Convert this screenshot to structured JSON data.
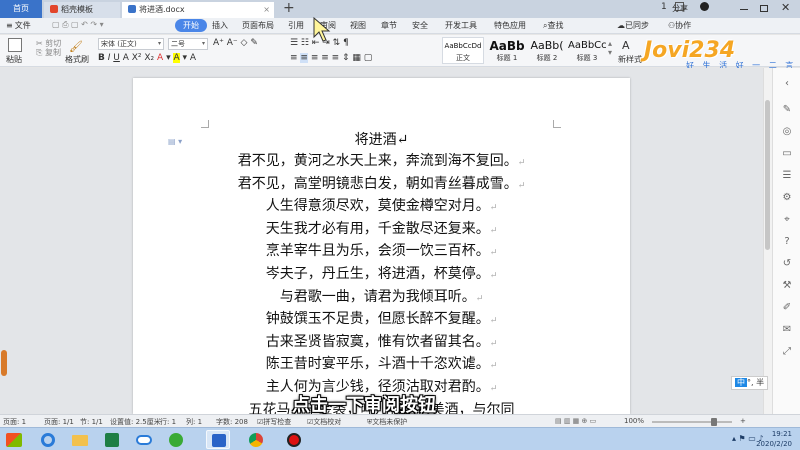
{
  "tabs": {
    "home": "首页",
    "docer": "稻壳模板",
    "document": "将进酒.docx",
    "new_tab": "+"
  },
  "window": {
    "badge": "1",
    "share": "分享",
    "sync": "已同步",
    "collab": "协作"
  },
  "menu": {
    "file": "文件",
    "items": [
      "开始",
      "插入",
      "页面布局",
      "引用",
      "审阅",
      "视图",
      "章节",
      "安全",
      "开发工具",
      "特色应用"
    ],
    "search": "查找"
  },
  "ribbon": {
    "paste": "粘贴",
    "cut": "剪切",
    "copy": "复制",
    "format_painter": "格式刷",
    "font_name": "宋体 (正文)",
    "font_size": "二号",
    "new_style": "新样式",
    "styles": [
      {
        "preview": "AaBbCcDd",
        "name": "正文"
      },
      {
        "preview": "AaBb",
        "name": "标题 1"
      },
      {
        "preview": "AaBb(",
        "name": "标题 2"
      },
      {
        "preview": "AaBbCc",
        "name": "标题 3"
      }
    ]
  },
  "document": {
    "title": "将进酒",
    "lines": [
      "君不见，黄河之水天上来，奔流到海不复回。",
      "君不见，高堂明镜悲白发，朝如青丝暮成雪。",
      "人生得意须尽欢，莫使金樽空对月。",
      "天生我才必有用，千金散尽还复来。",
      "烹羊宰牛且为乐，会须一饮三百杯。",
      "岑夫子，丹丘生，将进酒，杯莫停。",
      "与君歌一曲，请君为我倾耳听。",
      "钟鼓馔玉不足贵，但愿长醉不复醒。",
      "古来圣贤皆寂寞，惟有饮者留其名。",
      "陈王昔时宴平乐，斗酒十千恣欢谑。",
      "主人何为言少钱，径须沽取对君酌。",
      "五花马，千金裘，呼儿将出换美酒，与尔同"
    ],
    "paragraph_mark": "↵"
  },
  "status": {
    "page": "页面: 1",
    "pages": "页面: 1/1",
    "section": "节: 1/1",
    "setting": "设置值: 2.5厘米",
    "row": "行: 1",
    "col": "列: 1",
    "words": "字数: 208",
    "spellcheck": "拼写检查",
    "doc_check": "文档校对",
    "protect": "文档未保护",
    "zoom": "100%"
  },
  "subtitle": "点击一下审阅按钮",
  "watermark": "Jovi234",
  "watermark_sub": "好 生 活 好 一 二 言",
  "ime": {
    "zh": "中",
    "rest": "°, 半"
  },
  "clock": {
    "time": "19:21",
    "date": "2020/2/20"
  },
  "colors": {
    "accent": "#3a73c9",
    "start_tab": "#4a86e8",
    "subtitle_fill": "#ffffff",
    "taskbar": "#b9d2ee"
  }
}
